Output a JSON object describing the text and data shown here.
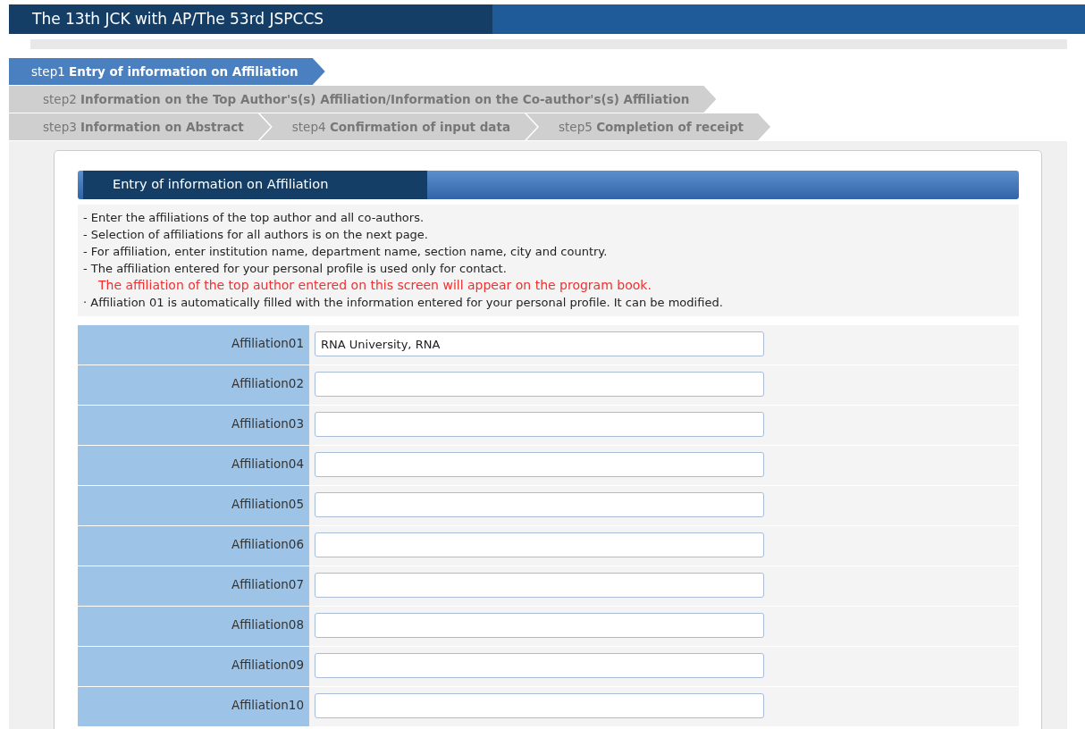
{
  "header": {
    "title": "The 13th JCK with AP/The 53rd JSPCCS"
  },
  "step_rows": [
    {
      "steps": [
        {
          "number": "step1",
          "label": "Entry of information on Affiliation",
          "selected": true
        }
      ]
    },
    {
      "steps": [
        {
          "number": "step2",
          "label": "Information on the Top Author's(s) Affiliation/Information on the Co-author's(s) Affiliation",
          "selected": false
        }
      ]
    },
    {
      "steps": [
        {
          "number": "step3",
          "label": "Information on Abstract",
          "selected": false
        },
        {
          "number": "step4",
          "label": "Confirmation of input data",
          "selected": false
        },
        {
          "number": "step5",
          "label": "Completion of receipt",
          "selected": false
        }
      ]
    }
  ],
  "section": {
    "title": "Entry of information on Affiliation",
    "notes": [
      {
        "kind": "note",
        "text": "- Enter the affiliations of the top author and all co-authors."
      },
      {
        "kind": "note",
        "text": "- Selection of affiliations for all authors is on the next page."
      },
      {
        "kind": "note",
        "text": "- For affiliation, enter institution name, department name, section name, city and country."
      },
      {
        "kind": "note",
        "text": "- The affiliation entered for your personal profile is used only for contact."
      },
      {
        "kind": "warning",
        "text": "The affiliation of the top author entered on this screen will appear on the program book."
      },
      {
        "kind": "note",
        "text": "· Affiliation 01 is automatically filled with the information entered for your personal profile. It can be modified."
      }
    ],
    "fields": [
      {
        "label": "Affiliation01",
        "value": "RNA University, RNA"
      },
      {
        "label": "Affiliation02"
      },
      {
        "label": "Affiliation03"
      },
      {
        "label": "Affiliation04"
      },
      {
        "label": "Affiliation05"
      },
      {
        "label": "Affiliation06"
      },
      {
        "label": "Affiliation07"
      },
      {
        "label": "Affiliation08"
      },
      {
        "label": "Affiliation09"
      },
      {
        "label": "Affiliation10"
      }
    ]
  }
}
